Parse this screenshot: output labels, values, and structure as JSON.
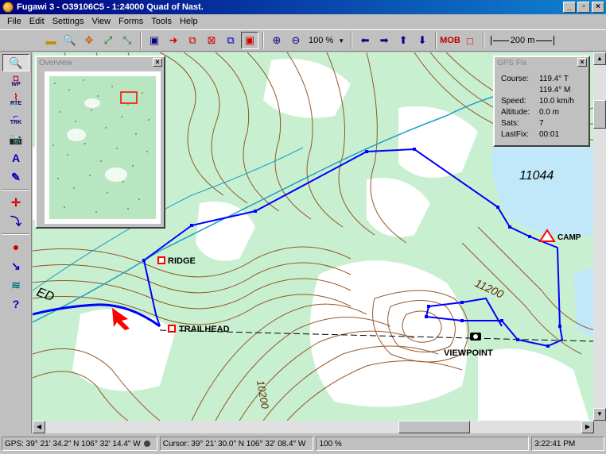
{
  "window": {
    "title": "Fugawi 3 - O39106C5 - 1:24000 Quad of Nast."
  },
  "menu": [
    "File",
    "Edit",
    "Settings",
    "View",
    "Forms",
    "Tools",
    "Help"
  ],
  "toolbar": {
    "zoom_value": "100 %",
    "mob_label": "MOB",
    "scale_label": "200 m"
  },
  "lefttools": {
    "wp_label": "WP",
    "rte_label": "RTE",
    "trk_label": "TRK"
  },
  "overview": {
    "title": "Overview"
  },
  "gps_panel": {
    "title": "GPS Fix",
    "rows": [
      {
        "label": "Course:",
        "value": "119.4° T"
      },
      {
        "label": "",
        "value": "119.4° M"
      },
      {
        "label": "Speed:",
        "value": "10.0 km/h"
      },
      {
        "label": "Altitude:",
        "value": "0.0 m"
      },
      {
        "label": "Sats:",
        "value": "7"
      },
      {
        "label": "LastFix:",
        "value": "00:01"
      }
    ]
  },
  "map": {
    "waypoints": {
      "ridge": "RIDGE",
      "trailhead": "TRAILHEAD",
      "camp": "CAMP",
      "viewpoint": "VIEWPOINT"
    },
    "elevations": {
      "e1044": "11044",
      "e1200": "11200",
      "e1020": "10200",
      "ed": "ED"
    }
  },
  "statusbar": {
    "gps": "GPS: 39° 21' 34.2\" N 106° 32' 14.4\" W",
    "cursor": "Cursor: 39° 21' 30.0\" N 106° 32' 08.4\" W",
    "zoom": "100 %",
    "time": "3:22:41 PM"
  },
  "colors": {
    "titlebar": "#000080",
    "map_green": "#c8f0d0",
    "contour": "#8b4513",
    "route": "#0000ff",
    "waypoint": "#ff0000",
    "water": "#c0e8f8"
  }
}
